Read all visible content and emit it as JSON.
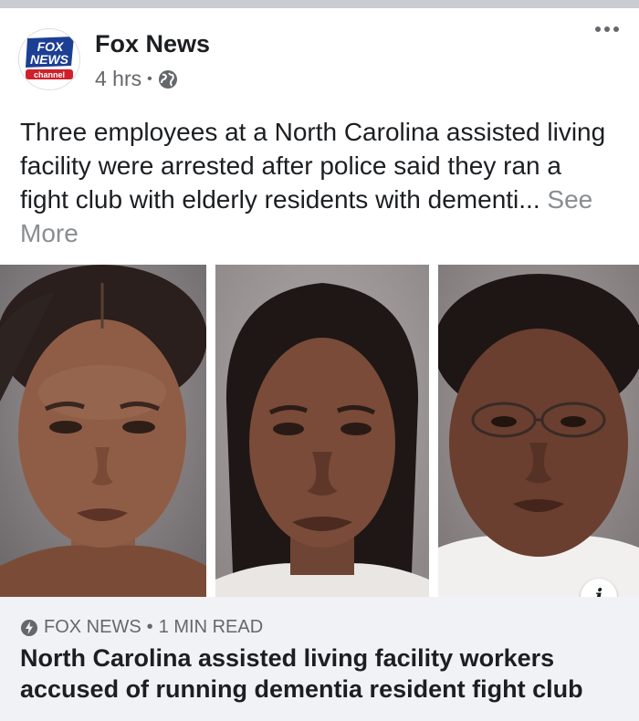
{
  "post": {
    "page_name": "Fox News",
    "time": "4 hrs",
    "separator": "•",
    "privacy_icon": "globe-icon",
    "menu_icon": "more-options-icon",
    "text": "Three employees at a North Carolina assisted living facility were arrested after police said they ran a fight club with elderly residents with dementi...",
    "see_more": "See More"
  },
  "logo": {
    "line1": "FOX",
    "line2": "NEWS",
    "line3": "channel",
    "colors": {
      "blue": "#1c3f94",
      "red": "#d0202b"
    }
  },
  "photos": [
    {
      "alt": "mugshot-1"
    },
    {
      "alt": "mugshot-2"
    },
    {
      "alt": "mugshot-3"
    }
  ],
  "info_button": "i",
  "link_preview": {
    "source_icon": "lightning-icon",
    "source": "FOX NEWS",
    "separator": "•",
    "read_time": "1 MIN READ",
    "headline": "North Carolina assisted living facility workers accused of running dementia resident fight club"
  }
}
